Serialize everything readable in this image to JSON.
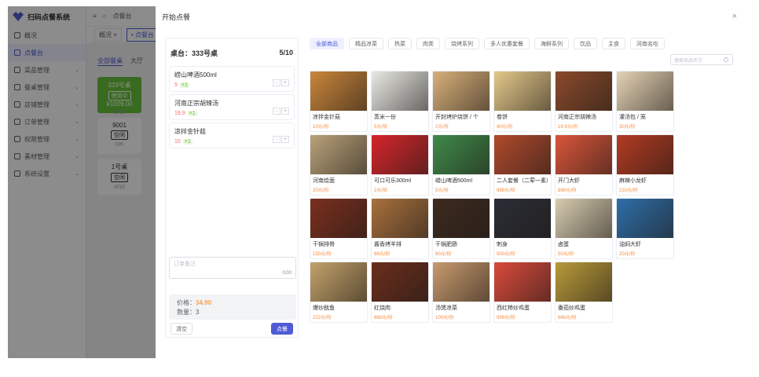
{
  "app": {
    "name": "扫码点餐系统",
    "menu": [
      {
        "label": "概况",
        "active": false,
        "expandable": false
      },
      {
        "label": "点餐台",
        "active": true,
        "expandable": false
      },
      {
        "label": "菜品管理",
        "active": false,
        "expandable": true
      },
      {
        "label": "餐桌管理",
        "active": false,
        "expandable": true
      },
      {
        "label": "店铺管理",
        "active": false,
        "expandable": true
      },
      {
        "label": "订单管理",
        "active": false,
        "expandable": true
      },
      {
        "label": "权限管理",
        "active": false,
        "expandable": true
      },
      {
        "label": "素材管理",
        "active": false,
        "expandable": true
      },
      {
        "label": "系统设置",
        "active": false,
        "expandable": true
      }
    ],
    "topbar_label": "点餐台",
    "tabs": [
      {
        "label": "概况 ×",
        "active": false
      },
      {
        "label": "• 点餐台 ×",
        "active": true
      }
    ],
    "filters": [
      "全部餐桌",
      "大厅"
    ],
    "tables": [
      {
        "name": "333号桌",
        "status": "使用中",
        "amount": "¥1009.00",
        "count": "5/10",
        "green": true
      },
      {
        "name": "9001",
        "status": "空闲",
        "amount": "",
        "count": "0/6",
        "green": false
      },
      {
        "name": "1号桌",
        "status": "空闲",
        "amount": "",
        "count": "0/10",
        "green": false
      }
    ]
  },
  "drawer": {
    "title": "开始点餐",
    "close_label": "×",
    "order": {
      "table_label": "桌台：333号桌",
      "count": "5/10",
      "items": [
        {
          "name": "崂山啤酒500ml",
          "price": "5",
          "qty": "×1"
        },
        {
          "name": "河南正宗胡辣汤",
          "price": "19.9",
          "qty": "×1"
        },
        {
          "name": "凉拌金针菇",
          "price": "10",
          "qty": "×1"
        }
      ],
      "stepper_minus": "-",
      "stepper_plus": "+",
      "remark_placeholder": "订单备注",
      "remark_count": "0/30",
      "price_label": "价格：",
      "price_value": "34.90",
      "qty_label": "数量：",
      "qty_value": "3",
      "clear_button": "清空",
      "submit_button": "点餐"
    },
    "categories": [
      {
        "label": "全部商品",
        "active": true
      },
      {
        "label": "精品凉菜",
        "active": false
      },
      {
        "label": "热菜",
        "active": false
      },
      {
        "label": "肉类",
        "active": false
      },
      {
        "label": "烧烤系列",
        "active": false
      },
      {
        "label": "多人优惠套餐",
        "active": false
      },
      {
        "label": "海鲜系列",
        "active": false
      },
      {
        "label": "饮品",
        "active": false
      },
      {
        "label": "主食",
        "active": false
      },
      {
        "label": "河南名吃",
        "active": false
      }
    ],
    "search_placeholder": "搜索商品名字",
    "dishes": [
      {
        "name": "凉拌金针菇",
        "price": "10元/份",
        "color": "#c9853a"
      },
      {
        "name": "蒸米一份",
        "price": "5元/份",
        "color": "#e9e9e4"
      },
      {
        "name": "开封烤炉烧饼 / 个",
        "price": "2元/份",
        "color": "#d8b07a"
      },
      {
        "name": "卷饼",
        "price": "40元/份",
        "color": "#e3c88a"
      },
      {
        "name": "河南正宗胡辣汤",
        "price": "19.9元/份",
        "color": "#8a4a2b"
      },
      {
        "name": "灌汤包 / 笼",
        "price": "30元/份",
        "color": "#e4d3b4"
      },
      {
        "name": "河南烩面",
        "price": "20元/份",
        "color": "#b9a27a"
      },
      {
        "name": "可口可乐300ml",
        "price": "2元/份",
        "color": "#d4262b"
      },
      {
        "name": "崂山啤酒500ml",
        "price": "5元/份",
        "color": "#3f8a4a"
      },
      {
        "name": "二人套餐（二荤一素）",
        "price": "888元/份",
        "color": "#b04a2c"
      },
      {
        "name": "开门大虾",
        "price": "896元/份",
        "color": "#d9553a"
      },
      {
        "name": "麻辣小龙虾",
        "price": "210元/份",
        "color": "#b23a22"
      },
      {
        "name": "干锅排骨",
        "price": "150元/份",
        "color": "#7a2f1e"
      },
      {
        "name": "酱香烤羊排",
        "price": "88元/份",
        "color": "#a8703d"
      },
      {
        "name": "干锅肥肠",
        "price": "80元/份",
        "color": "#3d2a1e"
      },
      {
        "name": "刺身",
        "price": "500元/份",
        "color": "#2a2d35"
      },
      {
        "name": "卤蛋",
        "price": "50元/份",
        "color": "#d7ccb0"
      },
      {
        "name": "油焖大虾",
        "price": "20元/份",
        "color": "#2e6ea8"
      },
      {
        "name": "爆炒鱿鱼",
        "price": "222元/份",
        "color": "#c3a26a"
      },
      {
        "name": "红烧肉",
        "price": "888元/份",
        "color": "#6a2e1c"
      },
      {
        "name": "汤煲凉菜",
        "price": "100元/份",
        "color": "#c89a6e"
      },
      {
        "name": "西红柿炒鸡蛋",
        "price": "999元/份",
        "color": "#d94a3a"
      },
      {
        "name": "番茄炒鸡蛋",
        "price": "666元/份",
        "color": "#b89a3a"
      }
    ]
  }
}
